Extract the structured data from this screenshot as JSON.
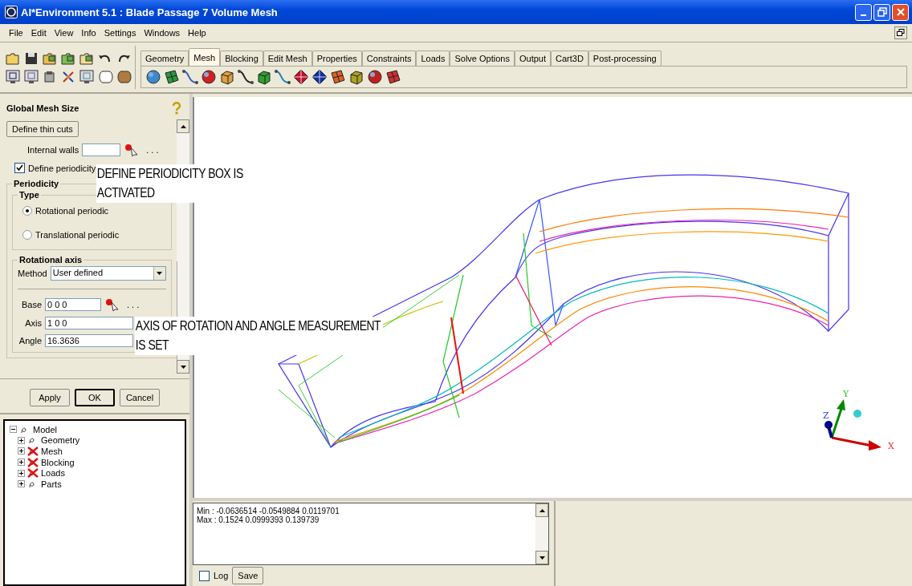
{
  "window": {
    "title": "AI*Environment 5.1 : Blade Passage 7 Volume Mesh"
  },
  "menu": [
    "File",
    "Edit",
    "View",
    "Info",
    "Settings",
    "Windows",
    "Help"
  ],
  "tabs": [
    {
      "label": "Geometry",
      "selected": false
    },
    {
      "label": "Mesh",
      "selected": true
    },
    {
      "label": "Blocking",
      "selected": false
    },
    {
      "label": "Edit Mesh",
      "selected": false
    },
    {
      "label": "Properties",
      "selected": false
    },
    {
      "label": "Constraints",
      "selected": false
    },
    {
      "label": "Loads",
      "selected": false
    },
    {
      "label": "Solve Options",
      "selected": false
    },
    {
      "label": "Output",
      "selected": false
    },
    {
      "label": "Cart3D",
      "selected": false
    },
    {
      "label": "Post-processing",
      "selected": false
    }
  ],
  "panel": {
    "title": "Global Mesh Size",
    "thin_cuts_button": "Define thin cuts",
    "internal_walls_label": "Internal walls",
    "dots": ". . .",
    "define_periodicity": {
      "label": "Define periodicity",
      "checked": true
    },
    "periodicity_title": "Periodicity",
    "type_title": "Type",
    "types": [
      {
        "label": "Rotational periodic",
        "selected": true
      },
      {
        "label": "Translational periodic",
        "selected": false
      }
    ],
    "axis_title": "Rotational axis",
    "method_label": "Method",
    "method_value": "User defined",
    "base_label": "Base",
    "base_value": "0 0 0",
    "axis_label": "Axis",
    "axis_value": "1 0 0",
    "angle_label": "Angle",
    "angle_value": "16.3636",
    "buttons": [
      "Apply",
      "OK",
      "Cancel"
    ]
  },
  "tree": [
    {
      "label": "Model",
      "expanded": true,
      "hidden": false,
      "children": [
        {
          "label": "Geometry",
          "expanded": false,
          "hidden": false
        },
        {
          "label": "Mesh",
          "expanded": false,
          "hidden": true
        },
        {
          "label": "Blocking",
          "expanded": false,
          "hidden": true
        },
        {
          "label": "Loads",
          "expanded": false,
          "hidden": true
        },
        {
          "label": "Parts",
          "expanded": false,
          "hidden": false
        }
      ]
    }
  ],
  "annotations": [
    {
      "lines": [
        "DEFINE PERIODICITY BOX IS",
        "ACTIVATED"
      ]
    },
    {
      "lines": [
        "AXIS OF ROTATION AND ANGLE MEASUREMENT",
        "IS SET"
      ]
    }
  ],
  "triad": {
    "x": "X",
    "y": "Y",
    "z": "Z"
  },
  "log": {
    "lines": [
      "Min : -0.0636514 -0.0549884 0.0119701",
      "Max : 0.1524 0.0999393 0.139739"
    ],
    "log_checkbox": {
      "label": "Log",
      "checked": false
    },
    "save_button": "Save"
  }
}
